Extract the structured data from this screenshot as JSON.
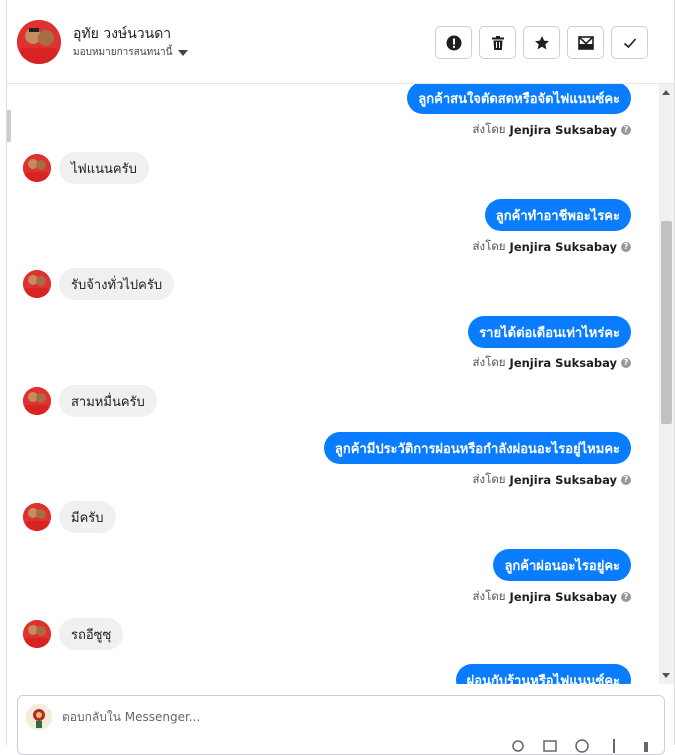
{
  "contact": {
    "name": "อุทัย วงษ์นวนดา",
    "assign_label": "มอบหมายการสนทนานี้"
  },
  "toolbar": {
    "buttons": [
      "spam-button",
      "delete-button",
      "star-button",
      "mark-unread-button",
      "done-button"
    ]
  },
  "messages": {
    "m0": {
      "text": "ลูกค้าสนใจตัดสดหรือจัดไฟแนนซ์คะ",
      "sent_prefix": "ส่งโดย",
      "sender": "Jenjira Suksabay"
    },
    "m1": {
      "text": "ไฟแนนครับ"
    },
    "m2": {
      "text": "ลูกค้าทำอาชีพอะไรคะ",
      "sent_prefix": "ส่งโดย",
      "sender": "Jenjira Suksabay"
    },
    "m3": {
      "text": "รับจ้างทั่วไปครับ"
    },
    "m4": {
      "text": "รายได้ต่อเดือนเท่าไหร่คะ",
      "sent_prefix": "ส่งโดย",
      "sender": "Jenjira Suksabay"
    },
    "m5": {
      "text": "สามหมื่นครับ"
    },
    "m6": {
      "text": "ลูกค้ามีประวัติการผ่อนหรือกำลังผ่อนอะไรอยู่ไหมคะ",
      "sent_prefix": "ส่งโดย",
      "sender": "Jenjira Suksabay"
    },
    "m7": {
      "text": "มีครับ"
    },
    "m8": {
      "text": "ลูกค้าผ่อนอะไรอยู่คะ",
      "sent_prefix": "ส่งโดย",
      "sender": "Jenjira Suksabay"
    },
    "m9": {
      "text": "รถอีซูซุ"
    },
    "m10": {
      "text": "ผ่อนกับร้านหรือไฟแนนซ์คะ"
    }
  },
  "composer": {
    "placeholder": "ตอบกลับใน Messenger..."
  },
  "colors": {
    "outgoing_bubble": "#0a7cff",
    "incoming_bubble": "#f0f0f0"
  }
}
